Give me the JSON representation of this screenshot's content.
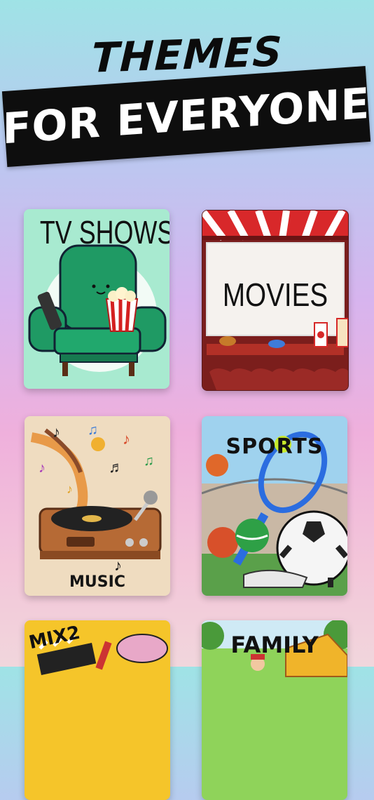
{
  "header": {
    "line1": "THEMES",
    "line2": "FOR EVERYONE"
  },
  "themes": [
    {
      "id": "tv",
      "label": "TV SHOWS",
      "icon": "armchair-popcorn-remote-icon"
    },
    {
      "id": "movies",
      "label": "MOVIES",
      "icon": "cinema-screen-icon"
    },
    {
      "id": "music",
      "label": "MUSIC",
      "icon": "record-player-icon"
    },
    {
      "id": "sports",
      "label": "SPORTS",
      "icon": "sports-balls-icon"
    },
    {
      "id": "mix",
      "label": "MIX2",
      "icon": "mixed-items-icon"
    },
    {
      "id": "family",
      "label": "FAMILY",
      "icon": "family-house-icon"
    }
  ],
  "colors": {
    "background_top": "#9fe3e6",
    "background_bottom": "#f1d6dc",
    "banner": "#0e0e0e"
  }
}
